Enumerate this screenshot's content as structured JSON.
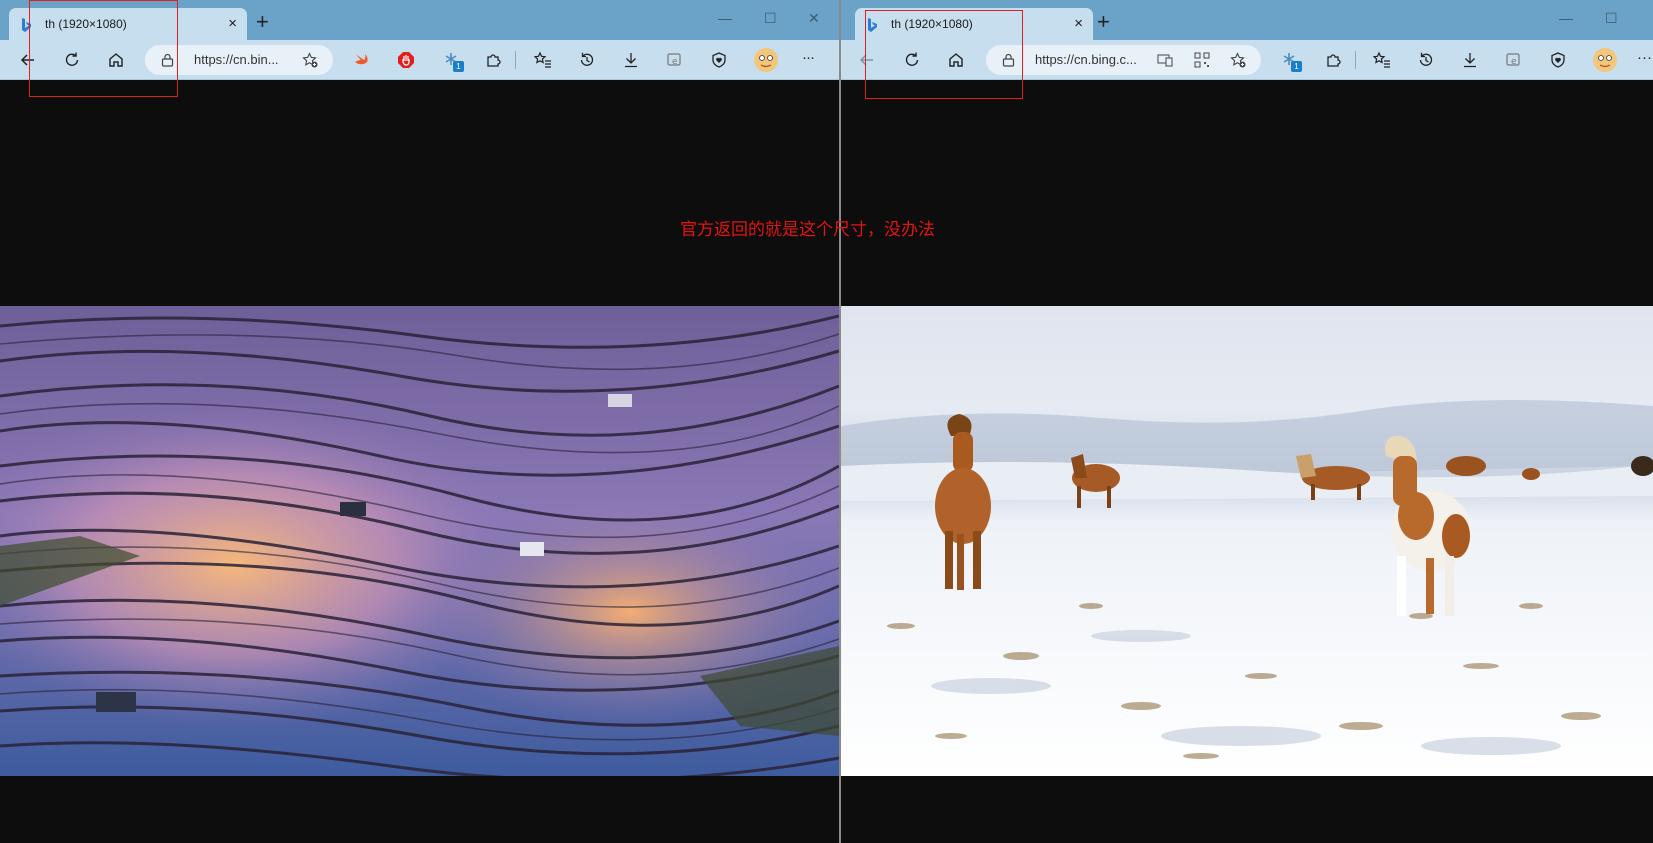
{
  "windows": [
    {
      "tab_title": "th (1920×1080)",
      "url": "https://cn.bin...",
      "extension_badge": "1"
    },
    {
      "tab_title": "th (1920×1080)",
      "url": "https://cn.bing.c...",
      "extension_badge": "1"
    }
  ],
  "annotation": "官方返回的就是这个尺寸，没办法",
  "icons": {
    "new_tab": "+",
    "close": "×",
    "more": "···",
    "minimize": "—",
    "maximize": "☐",
    "window_close": "✕"
  },
  "colors": {
    "annotation": "#e51414",
    "tab_bar": "#6aa3c7",
    "toolbar": "#c7deef",
    "page_background": "#0d0d0d"
  }
}
